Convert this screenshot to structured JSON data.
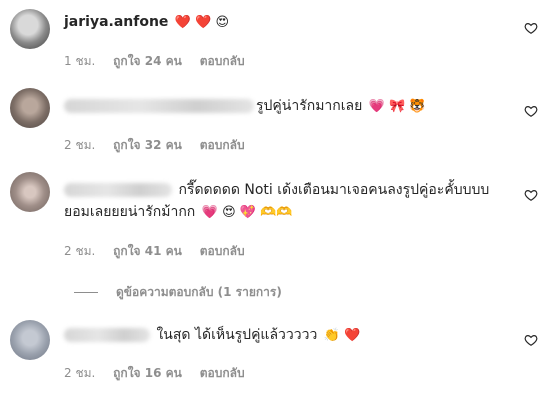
{
  "comments": [
    {
      "username": "jariya.anfone",
      "text": "",
      "emoji": "❤️ ❤️ 😍",
      "time": "1 ชม.",
      "likes": "ถูกใจ 24 คน",
      "reply": "ตอบกลับ"
    },
    {
      "username_hidden": true,
      "text": "รูปคู่น่ารักมากเลย",
      "emoji": "💗 🎀 🐯",
      "time": "2 ชม.",
      "likes": "ถูกใจ 32 คน",
      "reply": "ตอบกลับ"
    },
    {
      "username_hidden": true,
      "text": "กรี๊ดดดดด Noti เด้งเตือนมาเจอคนลงรูปคู่อะคั้บบบบ",
      "text2": "ยอมเลยยยน่ารักม้ากก",
      "emoji": "💗 😍 💖 🫶🫶",
      "time": "2 ชม.",
      "likes": "ถูกใจ 41 คน",
      "reply": "ตอบกลับ"
    },
    {
      "username_hidden": true,
      "text": "ในสุด ได้เห็นรูปคู่แล้ววววว",
      "emoji": "👏 ❤️",
      "time": "2 ชม.",
      "likes": "ถูกใจ 16 คน",
      "reply": "ตอบกลับ"
    }
  ],
  "view_replies": "ดูข้อความตอบกลับ (1 รายการ)",
  "icons": {
    "like": "heart-outline-icon"
  },
  "colors": {
    "text": "#262626",
    "meta": "#8e8e8e"
  }
}
